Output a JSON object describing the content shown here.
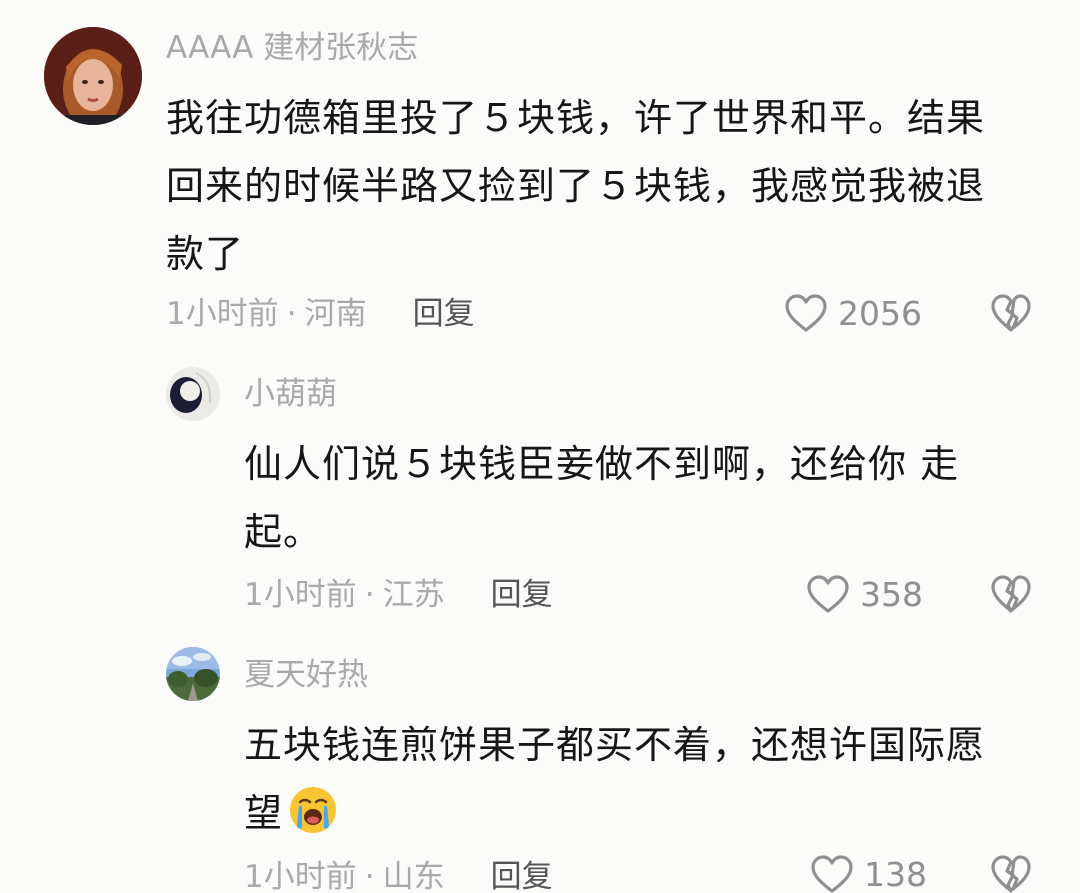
{
  "comments": [
    {
      "username": "AAAA 建材张秋志",
      "text": "我往功德箱里投了５块钱，许了世界和平。结果回来的时候半路又捡到了５块钱，我感觉我被退款了",
      "time": "1小时前",
      "location": "河南",
      "reply_label": "回复",
      "likes": "2056"
    },
    {
      "username": "小葫葫",
      "text": "仙人们说５块钱臣妾做不到啊，还给你 走起。",
      "time": "1小时前",
      "location": "江苏",
      "reply_label": "回复",
      "likes": "358"
    },
    {
      "username": "夏天好热",
      "text": "五块钱连煎饼果子都买不着，还想许国际愿望",
      "emoji": "crying-face-emoji",
      "time": "1小时前",
      "location": "山东",
      "reply_label": "回复",
      "likes": "138"
    }
  ],
  "icons": {
    "like": "heart-outline-icon",
    "dislike": "broken-heart-icon"
  },
  "colors": {
    "background": "#fbfbf9",
    "text": "#161616",
    "secondary": "#a9a9a9",
    "reply": "#555555"
  }
}
